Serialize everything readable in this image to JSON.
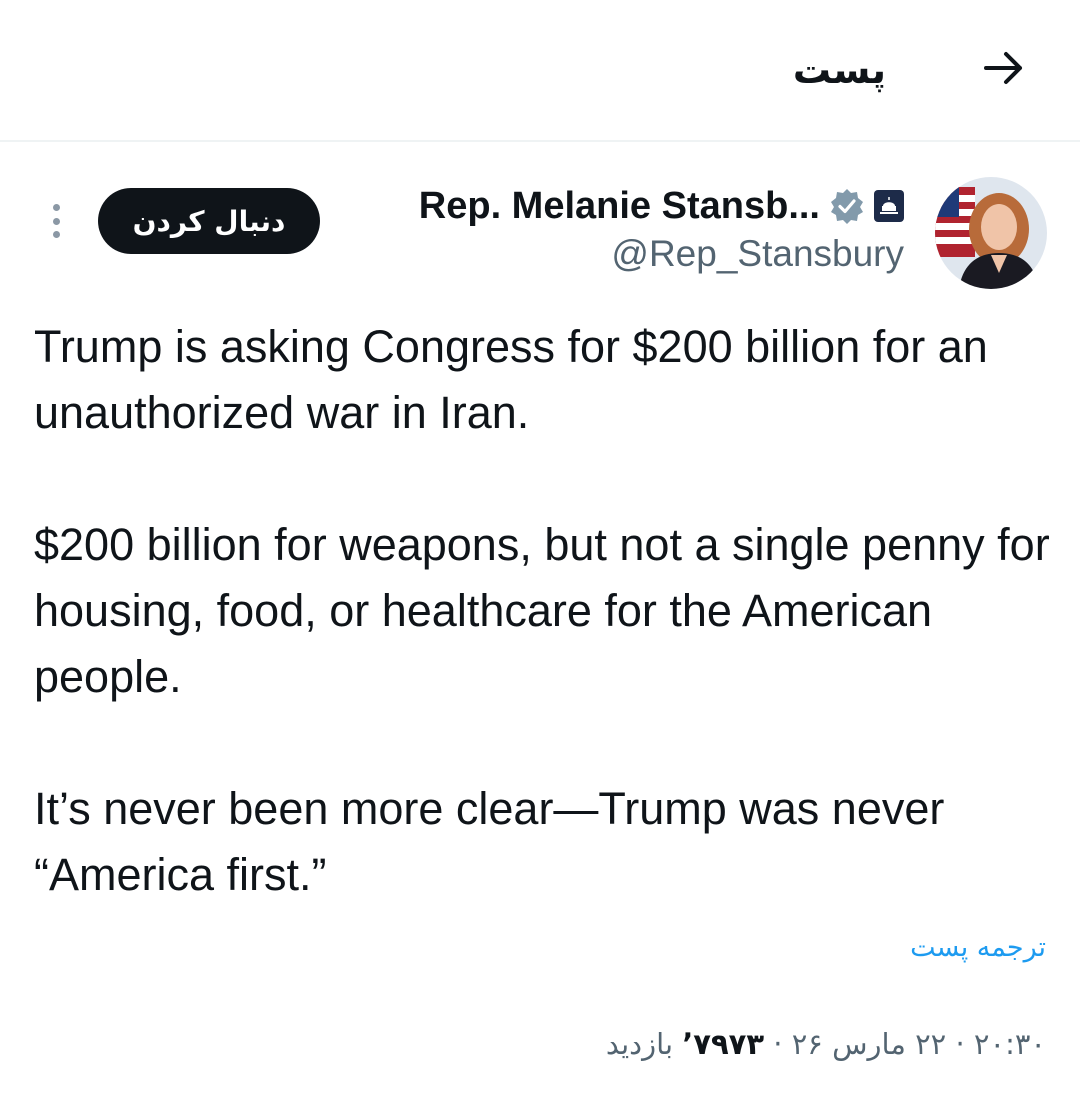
{
  "header": {
    "title": "پست",
    "back_icon": "arrow-right-icon"
  },
  "author": {
    "name": "Rep. Melanie Stansb...",
    "handle": "@Rep_Stansbury",
    "verified_icon": "verified-badge-icon",
    "affiliation_icon": "government-capitol-icon",
    "follow_label": "دنبال کردن",
    "more_icon": "more-vertical-icon"
  },
  "tweet": {
    "paragraphs": [
      "Trump is asking Congress for $200 billion for an unauthorized war in Iran.",
      "$200 billion for weapons, but not a single penny for housing, food, or healthcare for the American people.",
      "It’s never been more clear—Trump was never “America first.”"
    ],
    "translate_label": "ترجمه پست"
  },
  "meta": {
    "time": "۲۰:۳۰",
    "date": "۲۲ مارس ۲۶",
    "separator": "·",
    "views_count": "۷۹۷۳’",
    "views_label": "بازدید"
  },
  "colors": {
    "text": "#0f1419",
    "secondary": "#536471",
    "link": "#1d9bf0",
    "verified": "#829aab",
    "follow_bg": "#0f1419"
  }
}
